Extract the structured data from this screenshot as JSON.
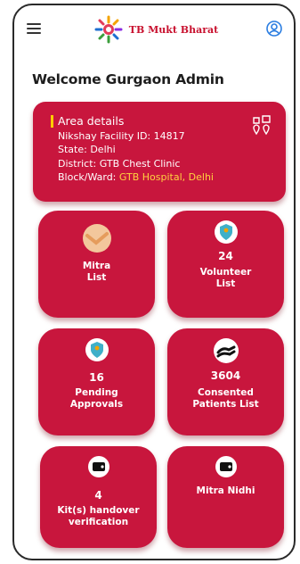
{
  "header": {
    "brand": "TB Mukt Bharat",
    "menu_icon": "hamburger-menu-icon",
    "profile_icon": "user-settings-icon",
    "logo_icon": "tb-mukt-bharat-logo"
  },
  "welcome": "Welcome Gurgaon Admin",
  "area": {
    "title": "Area details",
    "facility_label": "Nikshay Facility ID: ",
    "facility_value": "14817",
    "state_label": "State: ",
    "state_value": "Delhi",
    "district_label": "District: ",
    "district_value": "GTB Chest Clinic",
    "block_label": "Block/Ward: ",
    "block_value": "GTB Hospital, Delhi",
    "icon": "location-pins-icon",
    "colors": {
      "card": "#c8163d",
      "highlight": "#ffd23f",
      "bar": "#ffcc00"
    }
  },
  "tiles": [
    {
      "count": "",
      "label1": "Mitra",
      "label2": "List",
      "icon": "handshake-icon"
    },
    {
      "count": "24",
      "label1": "Volunteer",
      "label2": "List",
      "icon": "volunteer-shield-icon"
    },
    {
      "count": "16",
      "label1": "Pending",
      "label2": "Approvals",
      "icon": "approval-shield-icon"
    },
    {
      "count": "3604",
      "label1": "Consented",
      "label2": "Patients List",
      "icon": "care-hands-icon"
    },
    {
      "count": "4",
      "label1": "Kit(s) handover",
      "label2": "verification",
      "icon": "wallet-icon"
    },
    {
      "count": "",
      "label1": "Mitra Nidhi",
      "label2": "",
      "icon": "wallet-icon"
    }
  ]
}
